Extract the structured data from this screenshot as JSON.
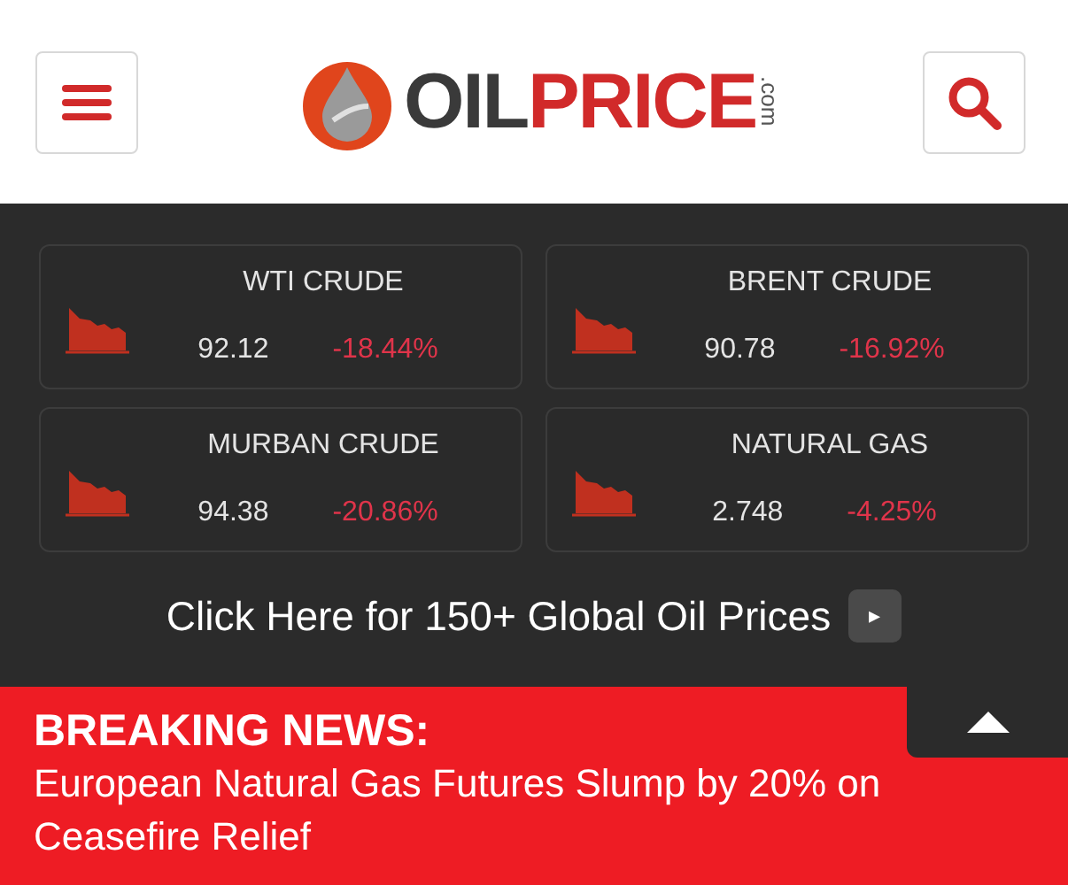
{
  "header": {
    "logo": {
      "part_1": "OIL",
      "part_2": "PRICE",
      "suffix": ".com"
    }
  },
  "prices": [
    {
      "name": "WTI CRUDE",
      "price": "92.12",
      "change": "-18.44%"
    },
    {
      "name": "BRENT CRUDE",
      "price": "90.78",
      "change": "-16.92%"
    },
    {
      "name": "MURBAN CRUDE",
      "price": "94.38",
      "change": "-20.86%"
    },
    {
      "name": "NATURAL GAS",
      "price": "2.748",
      "change": "-4.25%"
    }
  ],
  "more_link": {
    "label": "Click Here for 150+ Global Oil Prices",
    "arrow": "▸"
  },
  "breaking_news": {
    "heading": "BREAKING NEWS:",
    "headline": "European Natural Gas Futures Slump by 20% on Ceasefire Relief"
  }
}
